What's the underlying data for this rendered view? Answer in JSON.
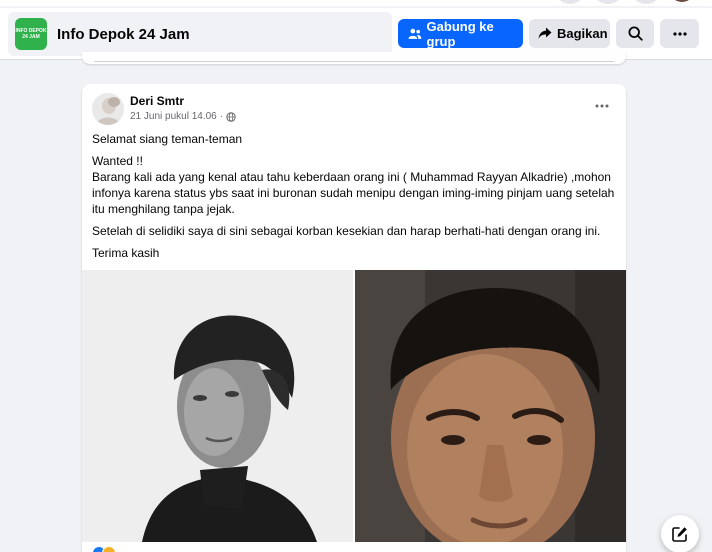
{
  "group": {
    "logo_text": "INFO DEPOK 24 JAM",
    "name": "Info Depok 24 Jam",
    "join_label": "Gabung ke grup",
    "share_label": "Bagikan"
  },
  "post": {
    "author": "Deri Smtr",
    "timestamp": "21 Juni pukul 14.06",
    "privacy_icon": "globe-icon",
    "paragraphs": [
      "Selamat siang teman-teman",
      "Wanted !!",
      "Barang kali ada yang kenal atau tahu keberdaan orang ini ( Muhammad Rayyan Alkadrie) ,mohon infonya karena status ybs saat ini buronan sudah menipu dengan iming-iming pinjam uang setelah itu menghilang tanpa jejak.",
      "Setelah di selidiki saya di sini sebagai korban kesekian dan harap berhati-hati dengan orang ini.",
      "Terima kasih"
    ]
  },
  "colors": {
    "primary": "#0866ff",
    "background": "#f0f2f5",
    "secondary_button": "#e4e6eb"
  }
}
